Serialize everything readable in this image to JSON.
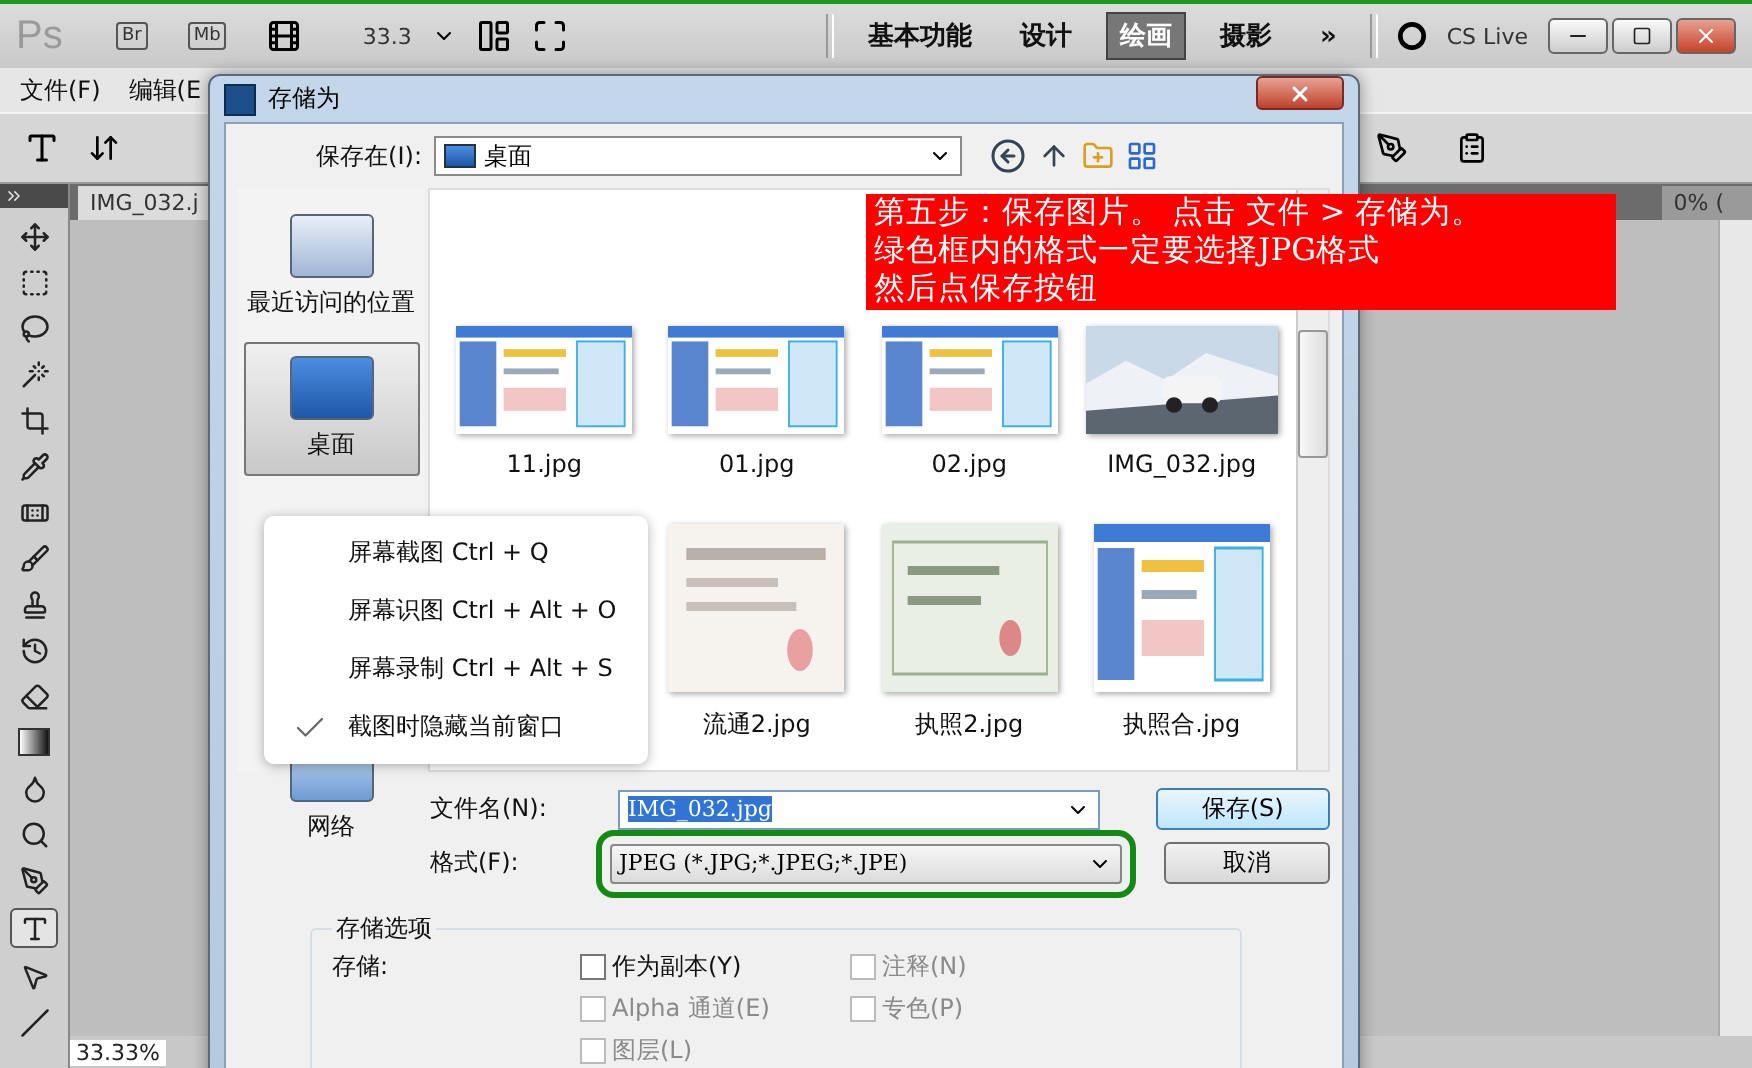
{
  "app_bar": {
    "logo": "Ps",
    "bridge": "Br",
    "mini_bridge": "Mb",
    "zoom": "33.3",
    "workspaces": [
      {
        "label": "基本功能",
        "selected": false
      },
      {
        "label": "设计",
        "selected": false
      },
      {
        "label": "绘画",
        "selected": true
      },
      {
        "label": "摄影",
        "selected": false
      }
    ],
    "more": "»",
    "cs_live": "CS Live"
  },
  "menu_bar": [
    "文件(F)",
    "编辑(E"
  ],
  "document": {
    "tab": "IMG_032.j",
    "second_tab": "0% (",
    "zoom_readout": "33.33%"
  },
  "dialog": {
    "title": "存储为",
    "save_in_label": "保存在(I):",
    "save_in_value": "桌面",
    "places": [
      {
        "label": "最近访问的位置",
        "selected": false
      },
      {
        "label": "桌面",
        "selected": true
      },
      {
        "label": "网络",
        "selected": false
      }
    ],
    "files": [
      {
        "name": "11.jpg"
      },
      {
        "name": "01.jpg"
      },
      {
        "name": "02.jpg"
      },
      {
        "name": "IMG_032.jpg"
      },
      {
        "name": "流通2.jpg"
      },
      {
        "name": "执照2.jpg"
      },
      {
        "name": "执照合.jpg"
      }
    ],
    "file_name_label": "文件名(N):",
    "file_name_value": "IMG_032.jpg",
    "format_label": "格式(F):",
    "format_value": "JPEG (*.JPG;*.JPEG;*.JPE)",
    "save_button": "保存(S)",
    "cancel_button": "取消",
    "options_title": "存储选项",
    "options_label": "存储:",
    "options": [
      {
        "label": "作为副本(Y)",
        "checked": false,
        "disabled": false
      },
      {
        "label": "注释(N)",
        "checked": false,
        "disabled": true
      },
      {
        "label": "Alpha 通道(E)",
        "checked": false,
        "disabled": true
      },
      {
        "label": "专色(P)",
        "checked": false,
        "disabled": true
      },
      {
        "label": "图层(L)",
        "checked": false,
        "disabled": true
      }
    ]
  },
  "context_menu": [
    {
      "kind": "command",
      "label": "屏幕截图 Ctrl + Q"
    },
    {
      "kind": "command",
      "label": "屏幕识图 Ctrl + Alt + O"
    },
    {
      "kind": "command",
      "label": "屏幕录制 Ctrl + Alt + S"
    },
    {
      "kind": "toggle",
      "label": "截图时隐藏当前窗口",
      "checked": true
    }
  ],
  "annotation": [
    "第五步：保存图片。 点击 文件 > 存储为。",
    "绿色框内的格式一定要选择JPG格式",
    "然后点保存按钮"
  ]
}
